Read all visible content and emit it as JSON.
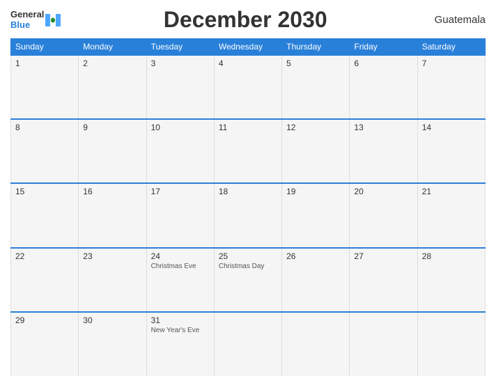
{
  "header": {
    "logo_general": "General",
    "logo_blue": "Blue",
    "title": "December 2030",
    "country": "Guatemala"
  },
  "weekdays": [
    "Sunday",
    "Monday",
    "Tuesday",
    "Wednesday",
    "Thursday",
    "Friday",
    "Saturday"
  ],
  "weeks": [
    [
      {
        "day": "1",
        "holiday": ""
      },
      {
        "day": "2",
        "holiday": ""
      },
      {
        "day": "3",
        "holiday": ""
      },
      {
        "day": "4",
        "holiday": ""
      },
      {
        "day": "5",
        "holiday": ""
      },
      {
        "day": "6",
        "holiday": ""
      },
      {
        "day": "7",
        "holiday": ""
      }
    ],
    [
      {
        "day": "8",
        "holiday": ""
      },
      {
        "day": "9",
        "holiday": ""
      },
      {
        "day": "10",
        "holiday": ""
      },
      {
        "day": "11",
        "holiday": ""
      },
      {
        "day": "12",
        "holiday": ""
      },
      {
        "day": "13",
        "holiday": ""
      },
      {
        "day": "14",
        "holiday": ""
      }
    ],
    [
      {
        "day": "15",
        "holiday": ""
      },
      {
        "day": "16",
        "holiday": ""
      },
      {
        "day": "17",
        "holiday": ""
      },
      {
        "day": "18",
        "holiday": ""
      },
      {
        "day": "19",
        "holiday": ""
      },
      {
        "day": "20",
        "holiday": ""
      },
      {
        "day": "21",
        "holiday": ""
      }
    ],
    [
      {
        "day": "22",
        "holiday": ""
      },
      {
        "day": "23",
        "holiday": ""
      },
      {
        "day": "24",
        "holiday": "Christmas Eve"
      },
      {
        "day": "25",
        "holiday": "Christmas Day"
      },
      {
        "day": "26",
        "holiday": ""
      },
      {
        "day": "27",
        "holiday": ""
      },
      {
        "day": "28",
        "holiday": ""
      }
    ],
    [
      {
        "day": "29",
        "holiday": ""
      },
      {
        "day": "30",
        "holiday": ""
      },
      {
        "day": "31",
        "holiday": "New Year's Eve"
      },
      {
        "day": "",
        "holiday": ""
      },
      {
        "day": "",
        "holiday": ""
      },
      {
        "day": "",
        "holiday": ""
      },
      {
        "day": "",
        "holiday": ""
      }
    ]
  ]
}
